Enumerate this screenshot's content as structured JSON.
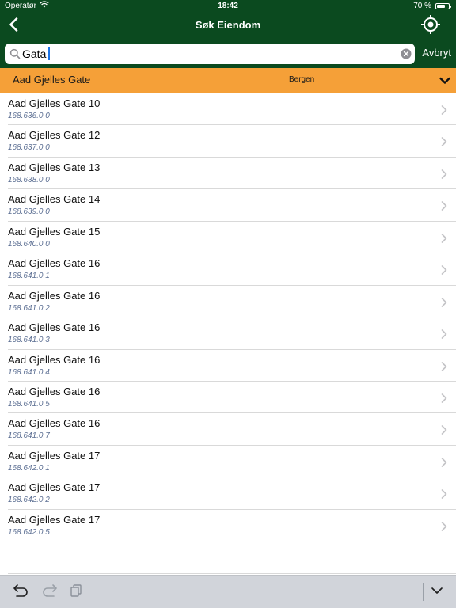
{
  "status_bar": {
    "carrier": "Operatør",
    "time": "18:42",
    "battery": "70 %",
    "battery_level": 0.7
  },
  "navigation": {
    "title": "Søk Eiendom",
    "back_icon": "chevron-left-icon",
    "locate_icon": "crosshair-icon"
  },
  "search": {
    "value": "Gata",
    "cancel_label": "Avbryt"
  },
  "street_header": {
    "name": "Aad Gjelles Gate",
    "city": "Bergen"
  },
  "results": [
    {
      "title": "Aad Gjelles Gate 10",
      "subtitle": "168.636.0.0"
    },
    {
      "title": "Aad Gjelles Gate 12",
      "subtitle": "168.637.0.0"
    },
    {
      "title": "Aad Gjelles Gate 13",
      "subtitle": "168.638.0.0"
    },
    {
      "title": "Aad Gjelles Gate 14",
      "subtitle": "168.639.0.0"
    },
    {
      "title": "Aad Gjelles Gate 15",
      "subtitle": "168.640.0.0"
    },
    {
      "title": "Aad Gjelles Gate 16",
      "subtitle": "168.641.0.1"
    },
    {
      "title": "Aad Gjelles Gate 16",
      "subtitle": "168.641.0.2"
    },
    {
      "title": "Aad Gjelles Gate 16",
      "subtitle": "168.641.0.3"
    },
    {
      "title": "Aad Gjelles Gate 16",
      "subtitle": "168.641.0.4"
    },
    {
      "title": "Aad Gjelles Gate 16",
      "subtitle": "168.641.0.5"
    },
    {
      "title": "Aad Gjelles Gate 16",
      "subtitle": "168.641.0.7"
    },
    {
      "title": "Aad Gjelles Gate 17",
      "subtitle": "168.642.0.1"
    },
    {
      "title": "Aad Gjelles Gate 17",
      "subtitle": "168.642.0.2"
    },
    {
      "title": "Aad Gjelles Gate 17",
      "subtitle": "168.642.0.5"
    }
  ],
  "colors": {
    "header_green": "#0b4a1f",
    "street_orange": "#f5a038",
    "subtitle_blue": "#5c6f93"
  },
  "toolbar": {
    "icons": [
      "undo-icon",
      "redo-icon",
      "paste-icon",
      "keyboard-dismiss-icon"
    ]
  }
}
